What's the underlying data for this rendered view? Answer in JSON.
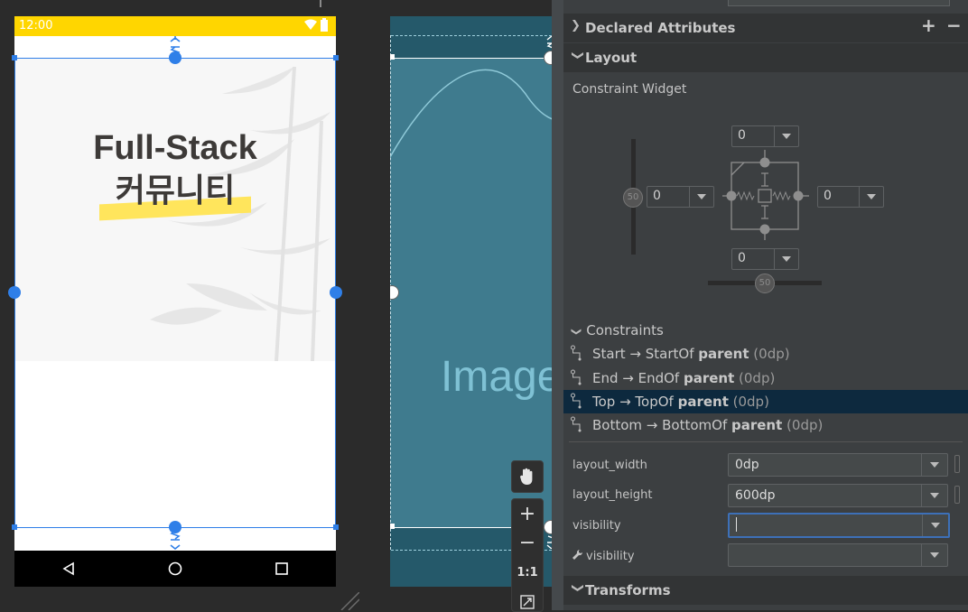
{
  "phone": {
    "status_time": "12:00",
    "hero_title": "Full-Stack",
    "hero_subtitle": "커뮤니티"
  },
  "blueprint": {
    "image_label": "Image"
  },
  "toolbar": {
    "pan_icon": "hand-icon",
    "zoom_in": "+",
    "zoom_out": "−",
    "actual_size": "1:1",
    "fit_icon": "fit-screen-icon"
  },
  "panel": {
    "declared_attributes": "Declared Attributes",
    "add": "+",
    "remove": "−",
    "layout_section": "Layout",
    "constraint_widget": "Constraint Widget",
    "margin_top": "0",
    "margin_start": "0",
    "margin_end": "0",
    "margin_bottom": "0",
    "bias_vertical": "50",
    "bias_horizontal": "50",
    "constraints_header": "Constraints",
    "constraints": [
      {
        "pre": "Start → StartOf ",
        "target": "parent",
        "dp": " (0dp)"
      },
      {
        "pre": "End → EndOf ",
        "target": "parent",
        "dp": " (0dp)"
      },
      {
        "pre": "Top → TopOf ",
        "target": "parent",
        "dp": " (0dp)"
      },
      {
        "pre": "Bottom → BottomOf ",
        "target": "parent",
        "dp": " (0dp)"
      }
    ],
    "layout_width_label": "layout_width",
    "layout_width_value": "0dp",
    "layout_height_label": "layout_height",
    "layout_height_value": "600dp",
    "visibility_label": "visibility",
    "visibility_value": "",
    "tools_visibility_label": "visibility",
    "tools_visibility_value": "",
    "transforms_section": "Transforms"
  },
  "colors": {
    "accent": "#2f7fe8",
    "status_bar": "#ffd600",
    "selected_row": "#0d293e",
    "blueprint": "#3a7a8d"
  }
}
